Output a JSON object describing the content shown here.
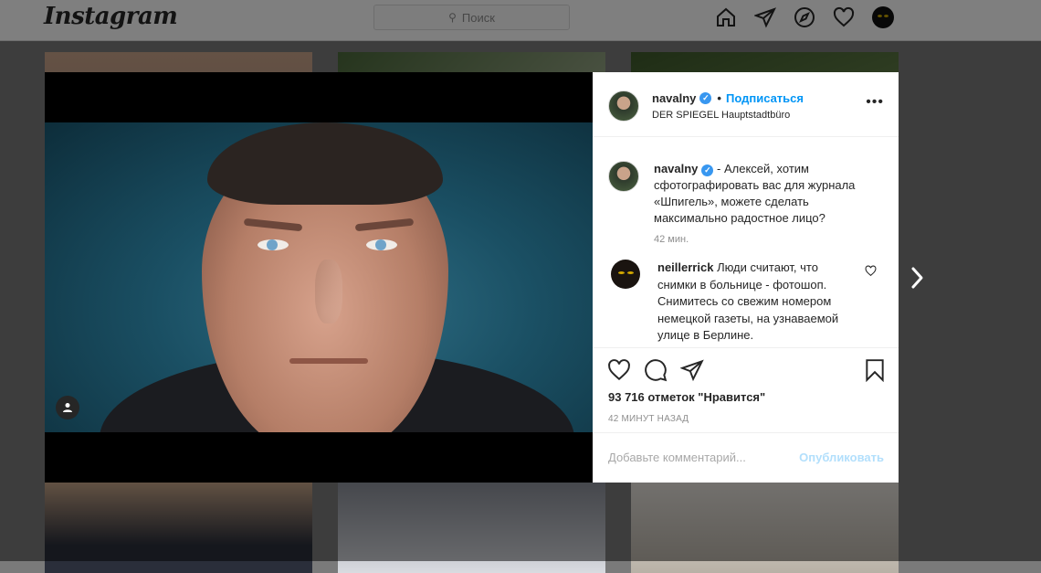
{
  "header": {
    "logo": "Instagram",
    "search_placeholder": "Поиск"
  },
  "post": {
    "username": "navalny",
    "verified": true,
    "separator": "•",
    "follow_label": "Подписаться",
    "location": "DER SPIEGEL Hauptstadtbüro",
    "more_label": "•••",
    "caption_text": "- Алексей, хотим сфотографировать вас для журнала «Шпигель», можете сделать максимально радостное лицо?",
    "caption_time": "42 мин.",
    "comment": {
      "username": "neillerrick",
      "text": "Люди считают, что снимки в больнице - фотошоп. Снимитесь со свежим номером немецкой газеты, на узнаваемой улице в Берлине."
    },
    "likes": "93 716 отметок \"Нравится\"",
    "posted_ago": "42 МИНУТ НАЗАД",
    "add_comment_placeholder": "Добавьте комментарий...",
    "publish_label": "Опубликовать"
  },
  "colors": {
    "accent": "#0095f6",
    "verified": "#3897f0",
    "publish_disabled": "#b2dffc"
  },
  "icons": [
    "search-icon",
    "home-icon",
    "direct-icon",
    "explore-icon",
    "heart-icon",
    "user-tag-icon",
    "like-icon",
    "comment-icon",
    "share-icon",
    "bookmark-icon",
    "next-arrow-icon"
  ]
}
